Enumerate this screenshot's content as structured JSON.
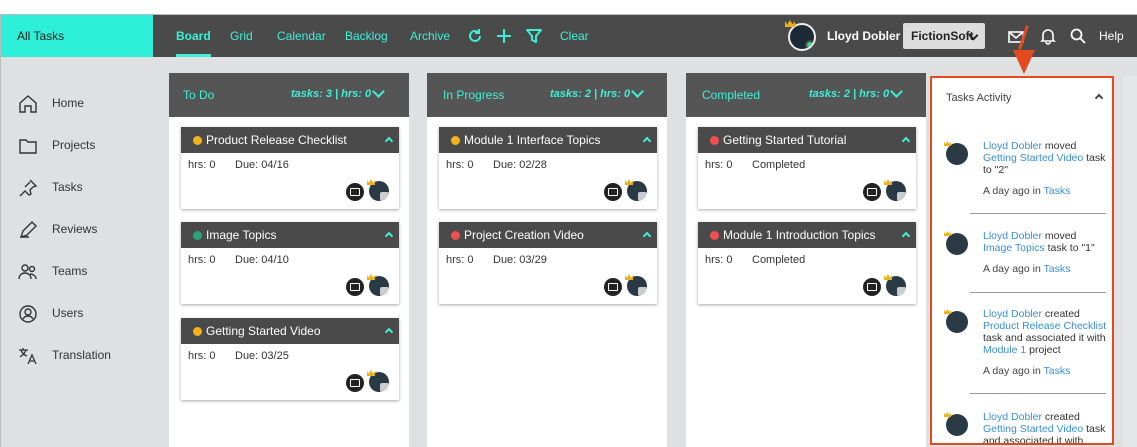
{
  "sidebar_header": "All Tasks",
  "nav": {
    "tabs": [
      "Board",
      "Grid",
      "Calendar",
      "Backlog",
      "Archive"
    ],
    "active": "Board",
    "icons": [
      "refresh-icon",
      "plus-icon",
      "filter-icon"
    ],
    "clear": "Clear"
  },
  "user": {
    "name": "Lloyd Dobler",
    "company": "FictionSoft"
  },
  "help": "Help",
  "sidebar": {
    "items": [
      {
        "label": "Home",
        "icon": "home-icon"
      },
      {
        "label": "Projects",
        "icon": "folder-icon"
      },
      {
        "label": "Tasks",
        "icon": "pin-icon"
      },
      {
        "label": "Reviews",
        "icon": "pen-icon"
      },
      {
        "label": "Teams",
        "icon": "team-icon"
      },
      {
        "label": "Users",
        "icon": "user-icon"
      },
      {
        "label": "Translation",
        "icon": "translate-icon"
      }
    ]
  },
  "columns": [
    {
      "title": "To Do",
      "stats": "tasks: 3 | hrs: 0",
      "cards": [
        {
          "title": "Product Release Checklist",
          "hrs": "hrs: 0",
          "due": "Due: 04/16",
          "color": "#f5b21f"
        },
        {
          "title": "Image Topics",
          "hrs": "hrs: 0",
          "due": "Due: 04/10",
          "color": "#2ba37a"
        },
        {
          "title": "Getting Started Video",
          "hrs": "hrs: 0",
          "due": "Due: 03/25",
          "color": "#f5b21f"
        }
      ]
    },
    {
      "title": "In Progress",
      "stats": "tasks: 2 | hrs: 0",
      "cards": [
        {
          "title": "Module 1 Interface Topics",
          "hrs": "hrs: 0",
          "due": "Due: 02/28",
          "color": "#f5b21f"
        },
        {
          "title": "Project Creation Video",
          "hrs": "hrs: 0",
          "due": "Due: 03/29",
          "color": "#ef4f4f"
        }
      ]
    },
    {
      "title": "Completed",
      "stats": "tasks: 2 | hrs: 0",
      "cards": [
        {
          "title": "Getting Started Tutorial",
          "hrs": "hrs: 0",
          "due": "Completed",
          "color": "#ef4f4f"
        },
        {
          "title": "Module 1 Introduction Topics",
          "hrs": "hrs: 0",
          "due": "Completed",
          "color": "#ef4f4f"
        }
      ]
    }
  ],
  "activity": {
    "title": "Tasks Activity",
    "entries": [
      {
        "user": "Lloyd Dobler",
        "verb": " moved ",
        "target": "Getting Started Video",
        "rest": " task to \"2\"",
        "time": "A day ago in ",
        "link": "Tasks"
      },
      {
        "user": "Lloyd Dobler",
        "verb": " moved ",
        "target": "Image Topics",
        "rest": " task to \"1\"",
        "time": "A day ago in ",
        "link": "Tasks"
      },
      {
        "user": "Lloyd Dobler",
        "verb": " created ",
        "target": "Product Release Checklist",
        "rest": " task and associated it with ",
        "target2": "Module 1",
        "rest2": " project",
        "time": "A day ago in ",
        "link": "Tasks"
      },
      {
        "user": "Lloyd Dobler",
        "verb": " created ",
        "target": "Getting Started Video",
        "rest": " task and associated it with",
        "time": "",
        "link": ""
      }
    ]
  }
}
